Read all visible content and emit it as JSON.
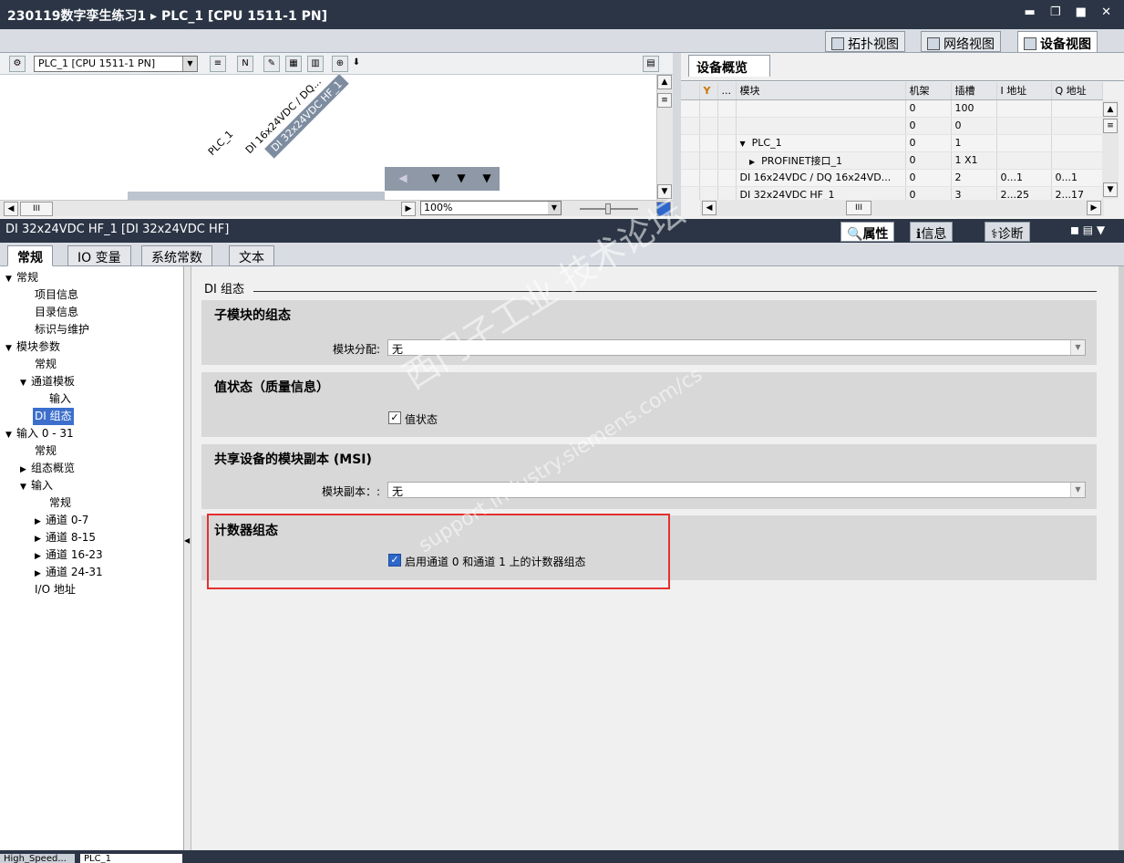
{
  "titlebar": {
    "title": "230119数字孪生练习1 ▸ PLC_1 [CPU 1511-1 PN]",
    "controls": "▬ ❐ ■ ✕"
  },
  "view_tabs": [
    {
      "label": "拓扑视图"
    },
    {
      "label": "网络视图"
    },
    {
      "label": "设备视图"
    }
  ],
  "device_toolbar": {
    "device_select": "PLC_1 [CPU 1511-1 PN]"
  },
  "canvas": {
    "labels": [
      "PLC_1",
      "DI 16x24VDC / DQ...",
      "DI 32x24VDC HF_1"
    ],
    "zoom": "100%"
  },
  "overview": {
    "tab": "设备概览",
    "columns": [
      "",
      "...",
      "模块",
      "机架",
      "插槽",
      "I 地址",
      "Q 地址"
    ],
    "rows": [
      {
        "module": "",
        "rack": "0",
        "slot": "100",
        "i": "",
        "q": ""
      },
      {
        "module": "",
        "rack": "0",
        "slot": "0",
        "i": "",
        "q": ""
      },
      {
        "module": "PLC_1",
        "rack": "0",
        "slot": "1",
        "i": "",
        "q": ""
      },
      {
        "module": "PROFINET接口_1",
        "rack": "0",
        "slot": "1 X1",
        "i": "",
        "q": ""
      },
      {
        "module": "DI 16x24VDC / DQ 16x24VD...",
        "rack": "0",
        "slot": "2",
        "i": "0...1",
        "q": "0...1"
      },
      {
        "module": "DI 32x24VDC HF_1",
        "rack": "0",
        "slot": "3",
        "i": "2...25",
        "q": "2...17"
      }
    ]
  },
  "inspector": {
    "title": "DI 32x24VDC HF_1 [DI 32x24VDC HF]",
    "tabs": [
      "属性",
      "信息",
      "诊断"
    ],
    "subtabs": [
      "常规",
      "IO 变量",
      "系统常数",
      "文本"
    ]
  },
  "tree": [
    {
      "label": "常规",
      "level": 0,
      "arrow": "▼"
    },
    {
      "label": "项目信息",
      "level": 1,
      "arrow": ""
    },
    {
      "label": "目录信息",
      "level": 1,
      "arrow": ""
    },
    {
      "label": "标识与维护",
      "level": 1,
      "arrow": ""
    },
    {
      "label": "模块参数",
      "level": 0,
      "arrow": "▼"
    },
    {
      "label": "常规",
      "level": 1,
      "arrow": ""
    },
    {
      "label": "通道模板",
      "level": 1,
      "arrow": "▼"
    },
    {
      "label": "输入",
      "level": 2,
      "arrow": ""
    },
    {
      "label": "DI 组态",
      "level": 1,
      "arrow": "",
      "selected": true
    },
    {
      "label": "输入 0 - 31",
      "level": 0,
      "arrow": "▼"
    },
    {
      "label": "常规",
      "level": 1,
      "arrow": ""
    },
    {
      "label": "组态概览",
      "level": 1,
      "arrow": "▶"
    },
    {
      "label": "输入",
      "level": 1,
      "arrow": "▼"
    },
    {
      "label": "常规",
      "level": 2,
      "arrow": ""
    },
    {
      "label": "通道 0-7",
      "level": 2,
      "arrow": "▶"
    },
    {
      "label": "通道 8-15",
      "level": 2,
      "arrow": "▶"
    },
    {
      "label": "通道 16-23",
      "level": 2,
      "arrow": "▶"
    },
    {
      "label": "通道 24-31",
      "level": 2,
      "arrow": "▶"
    },
    {
      "label": "I/O 地址",
      "level": 1,
      "arrow": ""
    }
  ],
  "content": {
    "heading": "DI 组态",
    "sections": {
      "submodule": {
        "title": "子模块的组态",
        "field_label": "模块分配:",
        "value": "无"
      },
      "value_status": {
        "title": "值状态（质量信息）",
        "checkbox_label": "值状态",
        "checked": true
      },
      "msi": {
        "title": "共享设备的模块副本 (MSI)",
        "field_label": "模块副本：:",
        "value": "无"
      },
      "counter": {
        "title": "计数器组态",
        "checkbox_label": "启用通道 0 和通道 1 上的计数器组态",
        "checked": true
      }
    }
  },
  "watermark": {
    "line1": "西门子工业 技术论坛",
    "line2": "support.industry.siemens.com/cs"
  },
  "bottom_tabs": [
    "High_Speed...",
    "PLC_1"
  ]
}
